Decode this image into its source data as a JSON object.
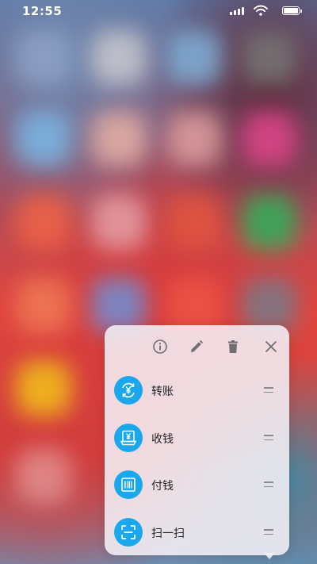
{
  "status_bar": {
    "time": "12:55"
  },
  "toolbar": {
    "info_icon": "info-icon",
    "edit_icon": "pencil-icon",
    "delete_icon": "trash-icon",
    "close_icon": "close-icon"
  },
  "menu": {
    "items": [
      {
        "label": "转账",
        "icon": "transfer-yuan-icon"
      },
      {
        "label": "收钱",
        "icon": "receive-money-icon"
      },
      {
        "label": "付钱",
        "icon": "pay-barcode-icon"
      },
      {
        "label": "扫一扫",
        "icon": "scan-icon"
      }
    ]
  },
  "colors": {
    "accent": "#1aa7ec",
    "menu_bg": "#f4f0f6"
  }
}
